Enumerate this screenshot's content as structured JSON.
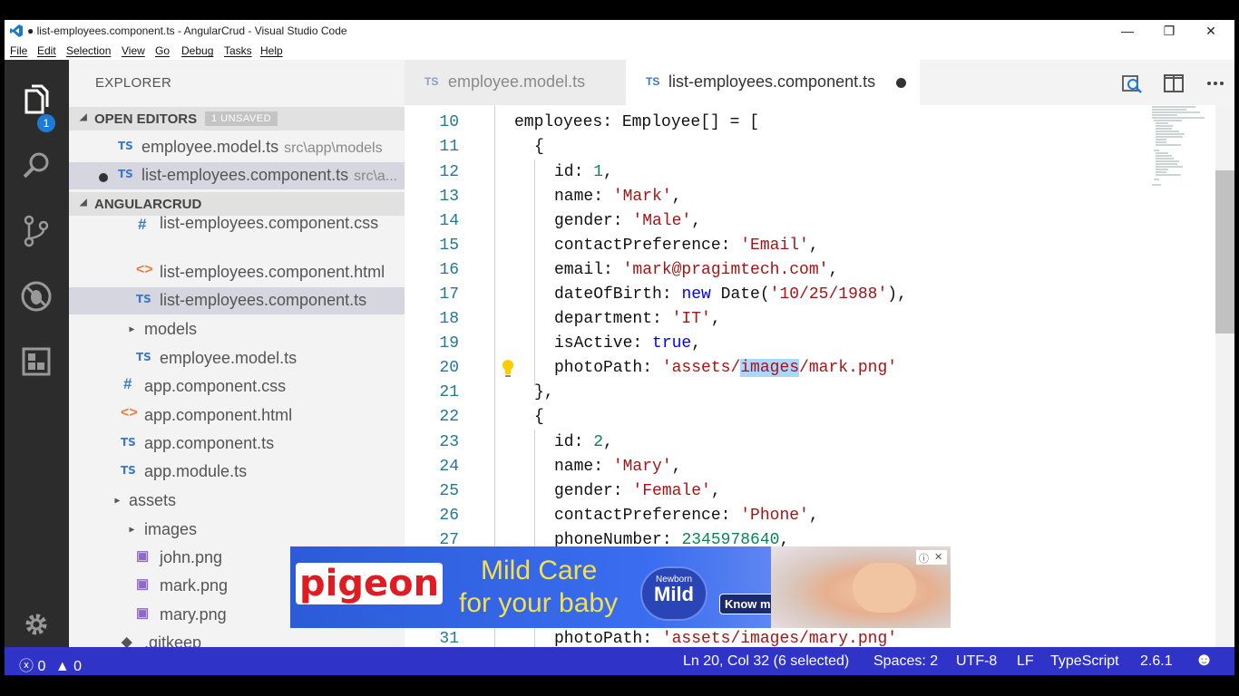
{
  "window": {
    "title": "● list-employees.component.ts - AngularCrud - Visual Studio Code"
  },
  "menu": [
    "File",
    "Edit",
    "Selection",
    "View",
    "Go",
    "Debug",
    "Tasks",
    "Help"
  ],
  "activity": {
    "explorer_badge": "1"
  },
  "explorer": {
    "title": "EXPLORER",
    "open_editors_label": "OPEN EDITORS",
    "unsaved_badge": "1 UNSAVED",
    "open_editors": [
      {
        "icon": "TS",
        "name": "employee.model.ts",
        "path": "src\\app\\models"
      },
      {
        "icon": "TS",
        "name": "list-employees.component.ts",
        "path": "src\\a..."
      }
    ],
    "project_label": "ANGULARCRUD",
    "tree": [
      {
        "icon": "#",
        "name": "list-employees.component.css"
      },
      {
        "icon": "<>",
        "name": "list-employees.component.html"
      },
      {
        "icon": "TS",
        "name": "list-employees.component.ts"
      },
      {
        "icon": "▲",
        "name": "models"
      },
      {
        "icon": "TS",
        "name": "employee.model.ts"
      },
      {
        "icon": "#",
        "name": "app.component.css"
      },
      {
        "icon": "<>",
        "name": "app.component.html"
      },
      {
        "icon": "TS",
        "name": "app.component.ts"
      },
      {
        "icon": "TS",
        "name": "app.module.ts"
      },
      {
        "icon": "▲",
        "name": "assets"
      },
      {
        "icon": "▲",
        "name": "images"
      },
      {
        "icon": "img",
        "name": "john.png"
      },
      {
        "icon": "img",
        "name": "mark.png"
      },
      {
        "icon": "img",
        "name": "mary.png"
      },
      {
        "icon": "◆",
        "name": ".gitkeep"
      }
    ]
  },
  "tabs": [
    {
      "icon": "TS",
      "label": "employee.model.ts"
    },
    {
      "icon": "TS",
      "label": "list-employees.component.ts"
    }
  ],
  "editor": {
    "line_numbers": [
      "10",
      "11",
      "12",
      "13",
      "14",
      "15",
      "16",
      "17",
      "18",
      "19",
      "20",
      "21",
      "22",
      "23",
      "24",
      "25",
      "26",
      "27",
      "31"
    ],
    "code": {
      "l10a": "employees: Employee[] = [",
      "l11a": "{",
      "l12a": "id: ",
      "l12n": "1",
      "l12b": ",",
      "l13a": "name: ",
      "l13s": "'Mark'",
      "l13b": ",",
      "l14a": "gender: ",
      "l14s": "'Male'",
      "l14b": ",",
      "l15a": "contactPreference: ",
      "l15s": "'Email'",
      "l15b": ",",
      "l16a": "email: ",
      "l16s": "'mark@pragimtech.com'",
      "l16b": ",",
      "l17a": "dateOfBirth: ",
      "l17k": "new",
      "l17b": " Date(",
      "l17s": "'10/25/1988'",
      "l17c": "),",
      "l18a": "department: ",
      "l18s": "'IT'",
      "l18b": ",",
      "l19a": "isActive: ",
      "l19k": "true",
      "l19b": ",",
      "l20a": "photoPath: ",
      "l20s1": "'assets/",
      "l20hl": "images",
      "l20s2": "/mark.png'",
      "l21a": "},",
      "l22a": "{",
      "l23a": "id: ",
      "l23n": "2",
      "l23b": ",",
      "l24a": "name: ",
      "l24s": "'Mary'",
      "l24b": ",",
      "l25a": "gender: ",
      "l25s": "'Female'",
      "l25b": ",",
      "l26a": "contactPreference: ",
      "l26s": "'Phone'",
      "l26b": ",",
      "l27a": "phoneNumber: ",
      "l27n": "2345978640",
      "l27b": ",",
      "l31a": "photoPath: ",
      "l31s": "'assets/images/mary.png'"
    }
  },
  "ad": {
    "brand": "pigeon",
    "headline1": "Mild Care",
    "headline2": "for your baby",
    "badge_small": "Newborn",
    "badge_big": "Mild",
    "cta": "Know more"
  },
  "statusbar": {
    "errors": "0",
    "warnings": "0",
    "position": "Ln 20, Col 32 (6 selected)",
    "spaces": "Spaces: 2",
    "encoding": "UTF-8",
    "eol": "LF",
    "language": "TypeScript",
    "version": "2.6.1"
  },
  "colors": {
    "activity_bar": "#2c2c2c",
    "statusbar": "#2f33c7",
    "string": "#a31515",
    "keyword": "#0000ff",
    "number": "#098658"
  }
}
